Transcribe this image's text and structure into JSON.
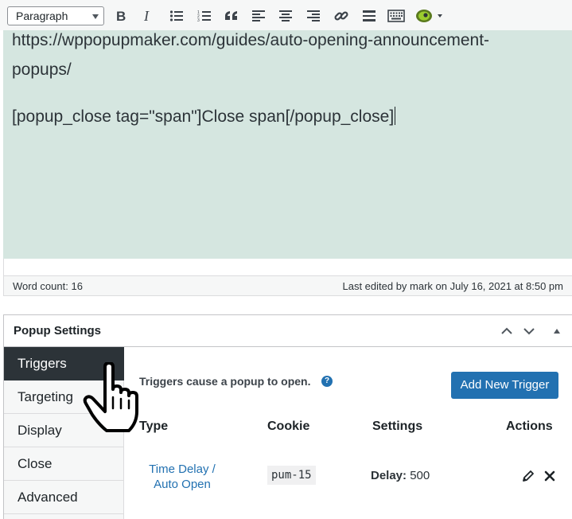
{
  "toolbar": {
    "format_value": "Paragraph",
    "icons": [
      "bold-icon",
      "italic-icon",
      "bulleted-list-icon",
      "numbered-list-icon",
      "blockquote-icon",
      "align-left-icon",
      "align-center-icon",
      "align-right-icon",
      "insert-link-icon",
      "horizontal-line-icon",
      "toolbar-toggle-icon",
      "popup-maker-icon"
    ]
  },
  "editor": {
    "lines": [
      "https://wppopupmaker.com/guides/auto-opening-announcement-",
      "popups/",
      "[popup_close tag=\"span\"]Close span[/popup_close]"
    ]
  },
  "status": {
    "word_count": "Word count: 16",
    "last_edited": "Last edited by mark on July 16, 2021 at 8:50 pm"
  },
  "metabox": {
    "title": "Popup Settings",
    "tabs": [
      "Triggers",
      "Targeting",
      "Display",
      "Close",
      "Advanced"
    ],
    "active_tab": "Triggers",
    "description": "Triggers cause a popup to open.",
    "help_symbol": "?",
    "add_button": "Add New Trigger",
    "columns": [
      "Type",
      "Cookie",
      "Settings",
      "Actions"
    ],
    "rows": [
      {
        "type_line1": "Time Delay /",
        "type_line2": "Auto Open",
        "cookie": "pum-15",
        "setting_label": "Delay:",
        "setting_value": "500"
      }
    ]
  },
  "colors": {
    "editor_bg": "#d5e6e0",
    "accent": "#2271b1",
    "active_tab_bg": "#2c3338"
  }
}
